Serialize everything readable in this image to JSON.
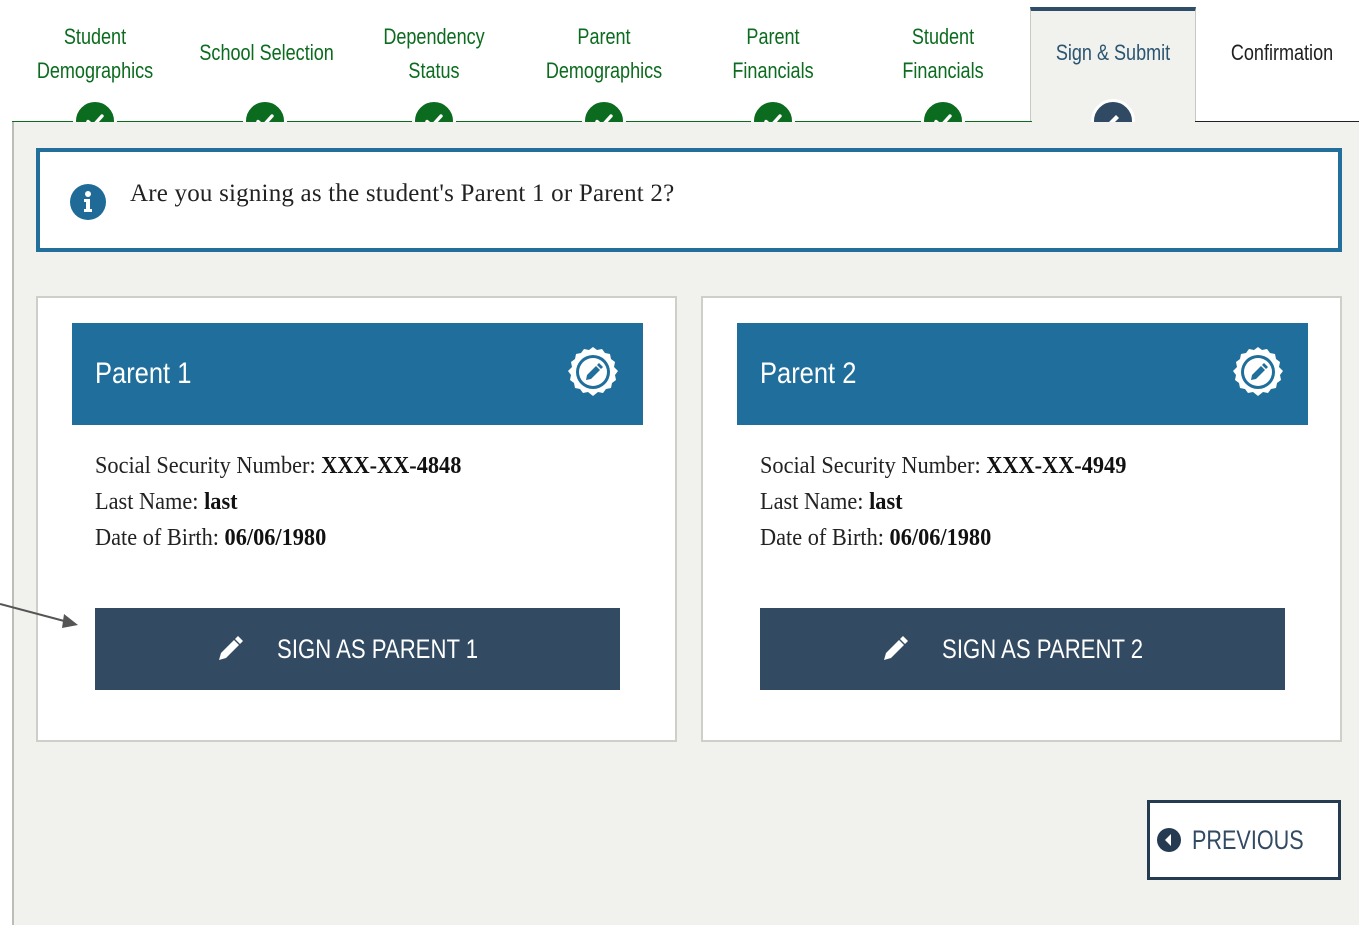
{
  "stepper": {
    "steps": [
      {
        "label_line1": "Student",
        "label_line2": "Demographics",
        "status": "complete"
      },
      {
        "label_line1": "School Selection",
        "label_line2": "",
        "status": "complete"
      },
      {
        "label_line1": "Dependency",
        "label_line2": "Status",
        "status": "complete"
      },
      {
        "label_line1": "Parent",
        "label_line2": "Demographics",
        "status": "complete"
      },
      {
        "label_line1": "Parent",
        "label_line2": "Financials",
        "status": "complete"
      },
      {
        "label_line1": "Student",
        "label_line2": "Financials",
        "status": "complete"
      },
      {
        "label_line1": "Sign & Submit",
        "label_line2": "",
        "status": "active"
      },
      {
        "label_line1": "Confirmation",
        "label_line2": "",
        "status": "upcoming"
      }
    ],
    "icons": {
      "complete": "checkmark-icon",
      "active": "pencil-icon"
    }
  },
  "info": {
    "icon": "info-icon",
    "message": "Are you signing as the student's Parent 1 or Parent 2?"
  },
  "parents": [
    {
      "title": "Parent 1",
      "badge_icon": "edit-badge-icon",
      "ssn_label": "Social Security Number: ",
      "ssn_value": "XXX-XX-4848",
      "last_name_label": "Last Name: ",
      "last_name_value": "last",
      "dob_label": "Date of Birth: ",
      "dob_value": "06/06/1980",
      "button_label": "SIGN AS PARENT 1"
    },
    {
      "title": "Parent 2",
      "badge_icon": "edit-badge-icon",
      "ssn_label": "Social Security Number: ",
      "ssn_value": "XXX-XX-4949",
      "last_name_label": "Last Name: ",
      "last_name_value": "last",
      "dob_label": "Date of Birth: ",
      "dob_value": "06/06/1980",
      "button_label": "SIGN AS PARENT 2"
    }
  ],
  "navigation": {
    "previous_label": "PREVIOUS",
    "previous_icon": "arrow-left-circle-icon"
  },
  "colors": {
    "complete_green": "#0b6b1e",
    "accent_blue": "#1f6e9b",
    "button_navy": "#324b63",
    "panel_background": "#f1f1ed"
  }
}
